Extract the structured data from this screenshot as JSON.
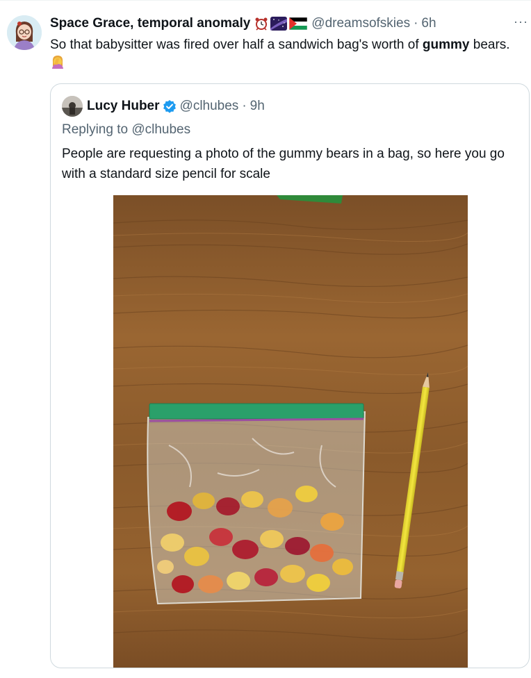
{
  "author": {
    "display_name": "Space Grace, temporal anomaly",
    "handle": "@dreamsofskies",
    "time": "6h",
    "emojis": [
      "alarm-clock-icon",
      "milky-way-icon",
      "palestine-flag-icon"
    ]
  },
  "tweet": {
    "text_before": "So that babysitter was fired over half a sandwich bag's worth of ",
    "text_bold": "gummy",
    "text_after": " bears.",
    "emoji": "woman-facepalming-icon"
  },
  "quote": {
    "display_name": "Lucy Huber",
    "verified": true,
    "handle": "@clhubes",
    "time": "9h",
    "replying_label": "Replying to",
    "replying_handle": "@clhubes",
    "text": "People are requesting a photo of the gummy bears in a bag, so here you go with a standard size pencil for scale"
  },
  "colors": {
    "text": "#0f1419",
    "secondary": "#536471",
    "link": "#1d9bf0",
    "border": "#cfd9de",
    "wood": "#8a5a2b"
  },
  "icons": {
    "more": "more-dots-icon",
    "verified": "verified-badge-icon"
  }
}
